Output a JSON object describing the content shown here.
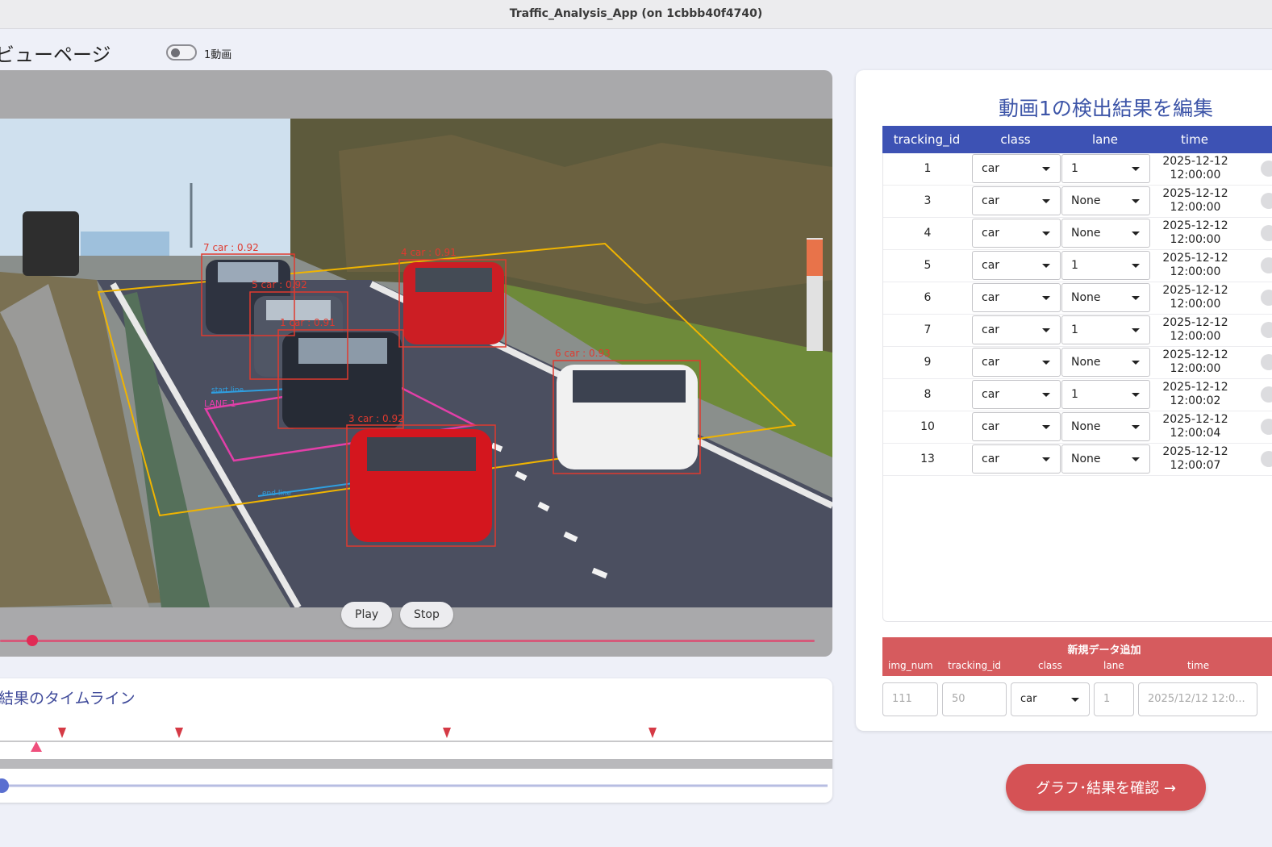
{
  "window": {
    "title": "Traffic_Analysis_App (on 1cbbb40f4740)"
  },
  "header": {
    "page_title": "ビューページ",
    "toggle_label": "1動画"
  },
  "video": {
    "play_label": "Play",
    "stop_label": "Stop",
    "detections": [
      {
        "label": "7 car : 0.92"
      },
      {
        "label": "5 car : 0.92"
      },
      {
        "label": "1 car : 0.91"
      },
      {
        "label": "4 car : 0.91"
      },
      {
        "label": "6 car : 0.93"
      },
      {
        "label": "3 car : 0.92"
      }
    ],
    "lane_label": "LANE 1",
    "start_label": "start line",
    "end_label": "end line"
  },
  "timeline": {
    "title": "結果のタイムライン"
  },
  "edit": {
    "title": "動画1の検出結果を編集",
    "columns": [
      "tracking_id",
      "class",
      "lane",
      "time"
    ],
    "rows": [
      {
        "tracking_id": "1",
        "class": "car",
        "lane": "1",
        "date": "2025-12-12",
        "clock": "12:00:00"
      },
      {
        "tracking_id": "3",
        "class": "car",
        "lane": "None",
        "date": "2025-12-12",
        "clock": "12:00:00"
      },
      {
        "tracking_id": "4",
        "class": "car",
        "lane": "None",
        "date": "2025-12-12",
        "clock": "12:00:00"
      },
      {
        "tracking_id": "5",
        "class": "car",
        "lane": "1",
        "date": "2025-12-12",
        "clock": "12:00:00"
      },
      {
        "tracking_id": "6",
        "class": "car",
        "lane": "None",
        "date": "2025-12-12",
        "clock": "12:00:00"
      },
      {
        "tracking_id": "7",
        "class": "car",
        "lane": "1",
        "date": "2025-12-12",
        "clock": "12:00:00"
      },
      {
        "tracking_id": "9",
        "class": "car",
        "lane": "None",
        "date": "2025-12-12",
        "clock": "12:00:00"
      },
      {
        "tracking_id": "8",
        "class": "car",
        "lane": "1",
        "date": "2025-12-12",
        "clock": "12:00:02"
      },
      {
        "tracking_id": "10",
        "class": "car",
        "lane": "None",
        "date": "2025-12-12",
        "clock": "12:00:04"
      },
      {
        "tracking_id": "13",
        "class": "car",
        "lane": "None",
        "date": "2025-12-12",
        "clock": "12:00:07"
      }
    ]
  },
  "add": {
    "title": "新規データ追加",
    "columns": [
      "img_num",
      "tracking_id",
      "class",
      "lane",
      "time"
    ],
    "placeholders": {
      "img_num": "111",
      "tracking_id": "50",
      "class_value": "car",
      "lane": "1",
      "time": "2025/12/12 12:0..."
    }
  },
  "cta": {
    "label": "グラフ･結果を確認 →"
  },
  "colors": {
    "accent_blue": "#3d52b4",
    "accent_red": "#d55255",
    "detection_box": "#e03a2f",
    "roi_line": "#f0b400"
  }
}
